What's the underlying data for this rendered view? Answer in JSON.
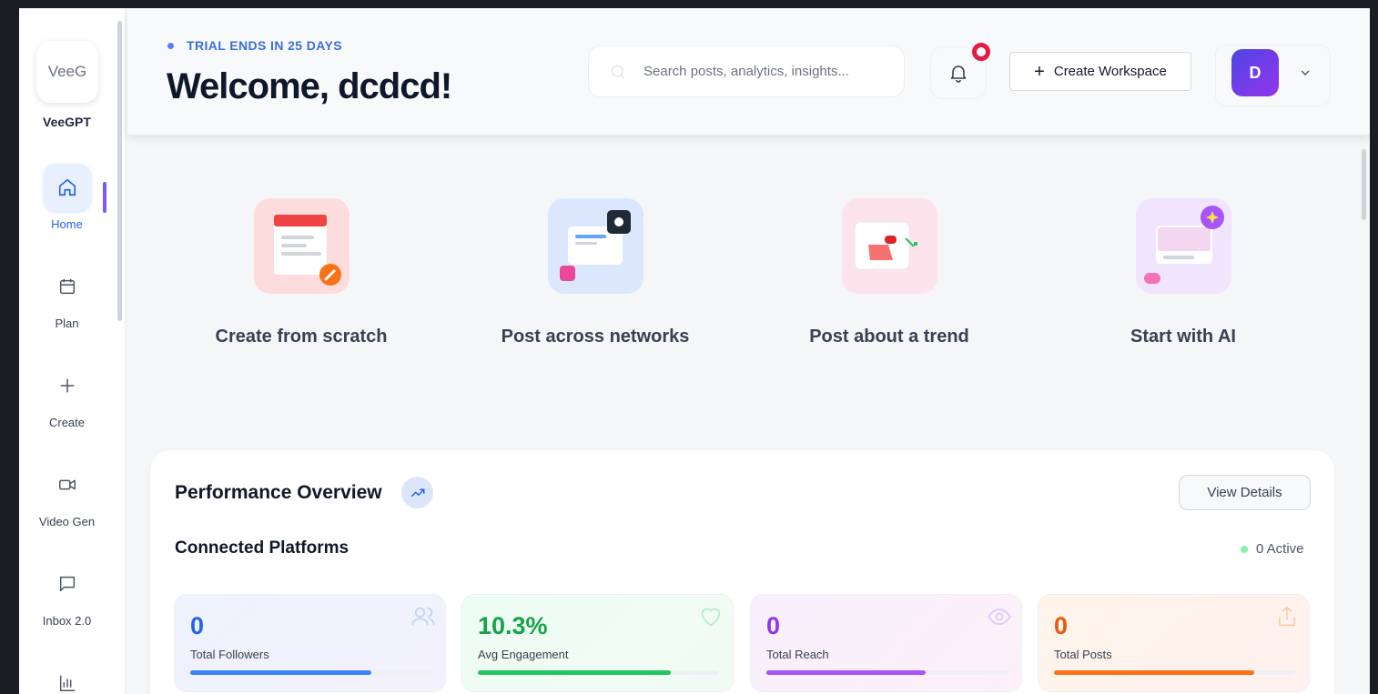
{
  "brand": {
    "name": "VeeGPT",
    "logo_alt": "VeeG"
  },
  "nav": [
    {
      "id": "home",
      "label": "Home",
      "active": true
    },
    {
      "id": "plan",
      "label": "Plan"
    },
    {
      "id": "create",
      "label": "Create"
    },
    {
      "id": "video",
      "label": "Video Gen"
    },
    {
      "id": "inbox",
      "label": "Inbox 2.0"
    },
    {
      "id": "analytics",
      "label": ""
    }
  ],
  "header": {
    "trial": "TRIAL ENDS IN 25 DAYS",
    "welcome": "Welcome, dcdcd!",
    "search_placeholder": "Search posts, analytics, insights...",
    "create_workspace": "Create Workspace",
    "avatar_initial": "D"
  },
  "quick_actions": [
    {
      "label": "Create from scratch"
    },
    {
      "label": "Post across networks"
    },
    {
      "label": "Post about a trend"
    },
    {
      "label": "Start with AI"
    }
  ],
  "performance": {
    "title": "Performance Overview",
    "view_details": "View Details",
    "connected_title": "Connected Platforms",
    "active_count": "0 Active",
    "stats": [
      {
        "value": "0",
        "label": "Total Followers",
        "progress": 0.75,
        "color": "#3b82f6",
        "icon": "users-icon"
      },
      {
        "value": "10.3%",
        "label": "Avg Engagement",
        "progress": 0.8,
        "color": "#22c55e",
        "icon": "heart-icon"
      },
      {
        "value": "0",
        "label": "Total Reach",
        "progress": 0.66,
        "color": "#a855f7",
        "icon": "eye-icon"
      },
      {
        "value": "0",
        "label": "Total Posts",
        "progress": 0.83,
        "color": "#f97316",
        "icon": "share-icon"
      }
    ]
  }
}
